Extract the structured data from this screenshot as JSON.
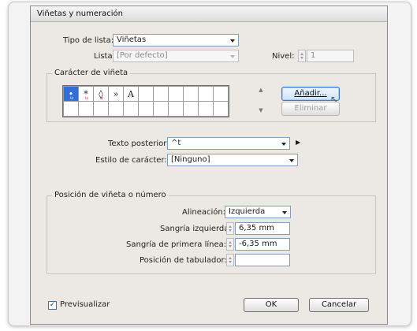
{
  "dialog": {
    "title": "Viñetas y numeración"
  },
  "list_type": {
    "label": "Tipo de lista:",
    "value": "Viñetas"
  },
  "list": {
    "label": "Lista:",
    "value": "[Por defecto]"
  },
  "level": {
    "label": "Nivel:",
    "value": "1"
  },
  "bullet_char": {
    "group_label": "Carácter de viñeta",
    "glyphs": [
      "•",
      "*",
      "◊",
      "»",
      "A"
    ],
    "subs": [
      "u",
      "u",
      "u",
      "",
      ""
    ],
    "add_label": "Añadir...",
    "delete_label": "Eliminar"
  },
  "text_after": {
    "label": "Texto posterior:",
    "value": "^t"
  },
  "char_style": {
    "label": "Estilo de carácter:",
    "value": "[Ninguno]"
  },
  "position": {
    "group_label": "Posición de viñeta o número",
    "alignment_label": "Alineación:",
    "alignment_value": "Izquierda",
    "left_indent_label": "Sangría izquierda:",
    "left_indent_value": "6,35 mm",
    "first_line_label": "Sangría de primera línea:",
    "first_line_value": "-6,35 mm",
    "tab_pos_label": "Posición de tabulador:",
    "tab_pos_value": ""
  },
  "footer": {
    "preview_label": "Previsualizar",
    "preview_checked": "✓",
    "ok_label": "OK",
    "cancel_label": "Cancelar"
  }
}
